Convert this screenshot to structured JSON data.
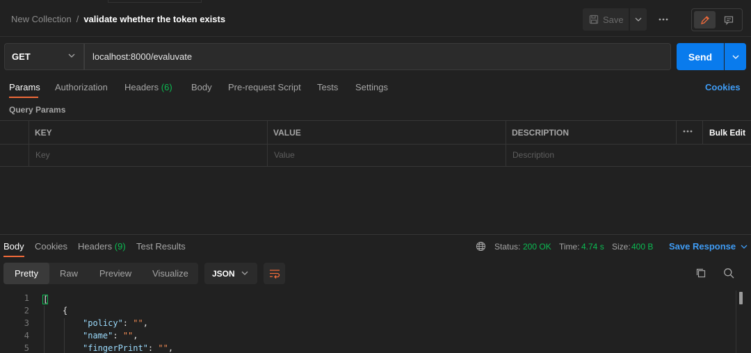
{
  "breadcrumb": {
    "collection": "New Collection",
    "separator": "/",
    "request": "validate whether the token exists"
  },
  "toolbar": {
    "save_label": "Save",
    "more": "•••"
  },
  "request": {
    "method": "GET",
    "url": "localhost:8000/evaluvate",
    "send_label": "Send"
  },
  "request_tabs": {
    "params": "Params",
    "authorization": "Authorization",
    "headers": "Headers",
    "headers_count": "(6)",
    "body": "Body",
    "prerequest": "Pre-request Script",
    "tests": "Tests",
    "settings": "Settings",
    "cookies": "Cookies"
  },
  "query_params": {
    "label": "Query Params",
    "columns": {
      "key": "KEY",
      "value": "VALUE",
      "description": "DESCRIPTION"
    },
    "bulk_edit": "Bulk Edit",
    "placeholders": {
      "key": "Key",
      "value": "Value",
      "description": "Description"
    }
  },
  "response_tabs": {
    "body": "Body",
    "cookies": "Cookies",
    "headers": "Headers",
    "headers_count": "(9)",
    "test_results": "Test Results"
  },
  "response_meta": {
    "status_label": "Status:",
    "status_value": "200 OK",
    "time_label": "Time:",
    "time_value": "4.74 s",
    "size_label": "Size:",
    "size_value": "400 B",
    "save_response": "Save Response"
  },
  "view_modes": {
    "pretty": "Pretty",
    "raw": "Raw",
    "preview": "Preview",
    "visualize": "Visualize"
  },
  "format": "JSON",
  "code": {
    "line_numbers": [
      "1",
      "2",
      "3",
      "4",
      "5"
    ],
    "open_array": "[",
    "open_object": "{",
    "keys": {
      "policy": "\"policy\"",
      "name": "\"name\"",
      "fingerprint": "\"fingerPrint\""
    },
    "values": {
      "policy": "\"\"",
      "name": "\"\"",
      "fingerprint": "\"\""
    }
  },
  "colors": {
    "accent": "#f26b3a",
    "primary": "#097bed",
    "link": "#3f9cf5",
    "success": "#0cbb52",
    "background": "#212121"
  }
}
